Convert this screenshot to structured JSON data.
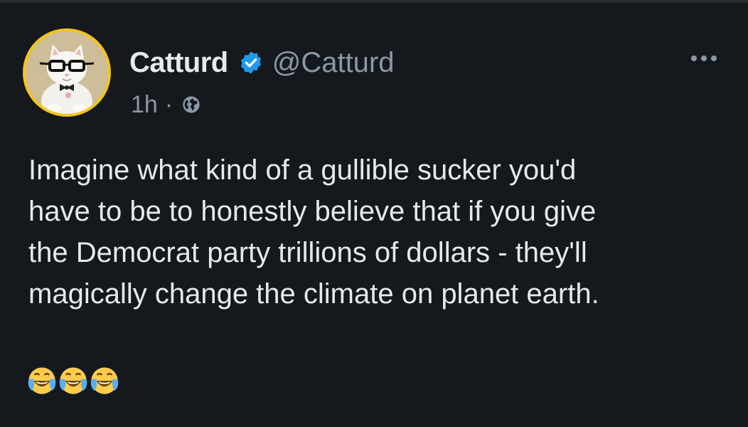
{
  "tweet": {
    "display_name": "Catturd",
    "handle": "@Catturd",
    "timestamp": "1h",
    "separator": "·",
    "text_lines": [
      "Imagine what kind of a gullible sucker you'd",
      "have to be to honestly believe that if you give",
      "the Democrat party trillions of dollars - they'll",
      "magically change the climate on planet earth."
    ],
    "emoji": [
      "face-with-tears-of-joy-icon",
      "face-with-tears-of-joy-icon",
      "face-with-tears-of-joy-icon"
    ],
    "icons": {
      "verified": "verified-badge-icon",
      "audience": "globe-icon",
      "menu": "more-options-icon"
    },
    "colors": {
      "background": "#15181d",
      "text": "#e7e9ea",
      "muted": "#8b98a5",
      "verified_blue": "#1d9bf0",
      "avatar_ring": "#f2c51a"
    }
  }
}
